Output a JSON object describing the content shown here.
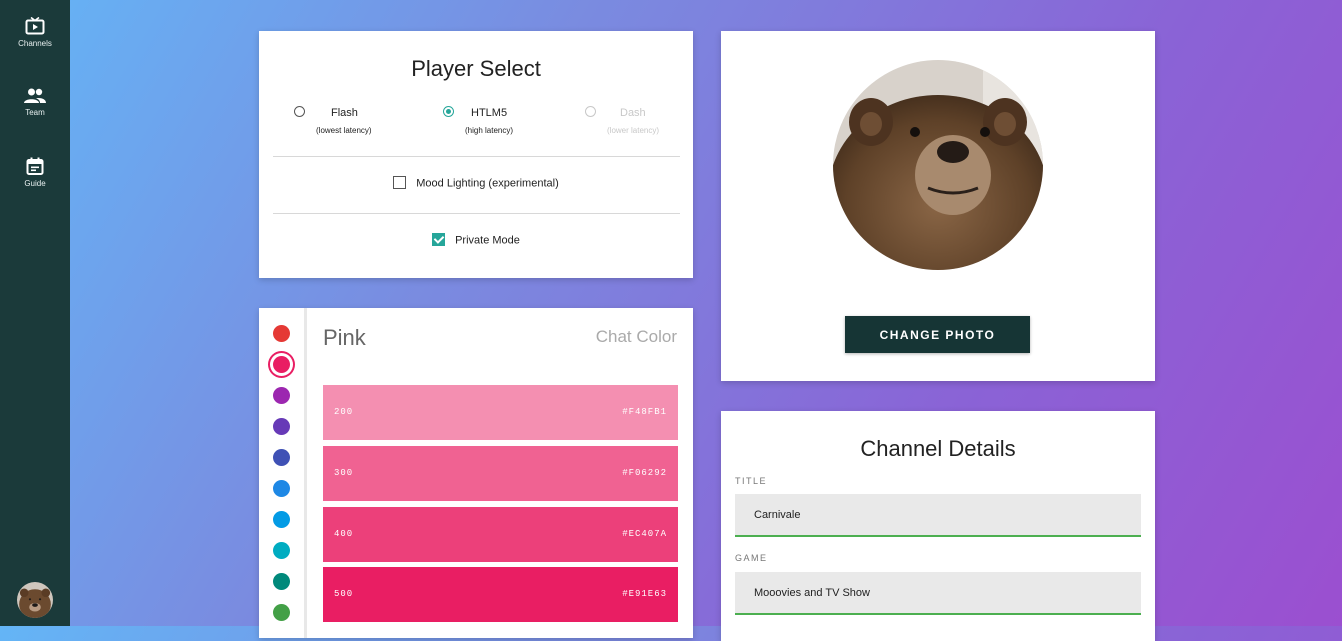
{
  "sidebar": {
    "items": [
      {
        "label": "Channels",
        "icon": "tv-icon"
      },
      {
        "label": "Team",
        "icon": "group-icon"
      },
      {
        "label": "Guide",
        "icon": "calendar-icon"
      }
    ],
    "avatar": "bear-avatar"
  },
  "player_select": {
    "title": "Player Select",
    "options": [
      {
        "label": "Flash",
        "sub": "(lowest latency)",
        "state": "unchecked"
      },
      {
        "label": "HTLM5",
        "sub": "(high latency)",
        "state": "checked"
      },
      {
        "label": "Dash",
        "sub": "(lower latency)",
        "state": "disabled"
      }
    ],
    "mood_lighting": {
      "label": "Mood Lighting (experimental)",
      "checked": false
    },
    "private_mode": {
      "label": "Private Mode",
      "checked": true
    },
    "accent_color": "#26a69a"
  },
  "color_picker": {
    "name": "Pink",
    "heading": "Chat Color",
    "swatches": [
      "#e53935",
      "#e91e63",
      "#9c27b0",
      "#673ab7",
      "#3f51b5",
      "#1e88e5",
      "#039be5",
      "#00acc1",
      "#00897b",
      "#43a047"
    ],
    "selected_index": 1,
    "shades": [
      {
        "level": "200",
        "hex": "#F48FB1",
        "color": "#f48fb1"
      },
      {
        "level": "300",
        "hex": "#F06292",
        "color": "#f06292"
      },
      {
        "level": "400",
        "hex": "#EC407A",
        "color": "#ec407a"
      },
      {
        "level": "500",
        "hex": "#E91E63",
        "color": "#e91e63"
      }
    ]
  },
  "photo": {
    "image": "bear-photo",
    "button_label": "CHANGE PHOTO",
    "button_color": "#163535"
  },
  "channel_details": {
    "title": "Channel Details",
    "title_label": "TITLE",
    "title_value": "Carnivale",
    "game_label": "GAME",
    "game_value": "Mooovies and TV Show"
  }
}
